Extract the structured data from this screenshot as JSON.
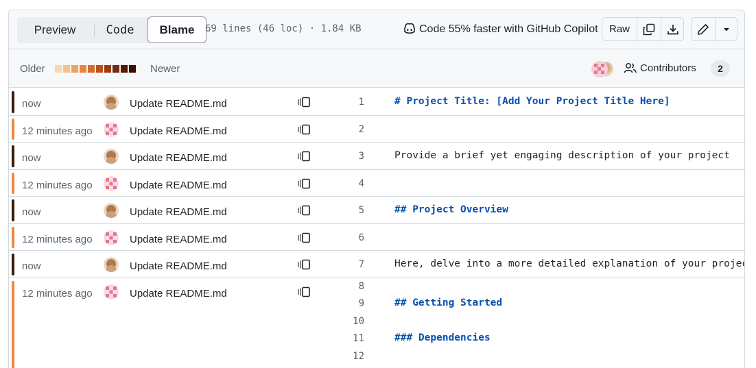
{
  "toolbar": {
    "tabs": {
      "preview": "Preview",
      "code": "Code",
      "blame": "Blame"
    },
    "file_info": "69 lines (46 loc) · 1.84 KB",
    "copilot_text": "Code 55% faster with GitHub Copilot",
    "raw_label": "Raw",
    "icons": [
      "copilot-icon",
      "copy-icon",
      "download-icon",
      "pencil-icon",
      "triangle-down-icon"
    ]
  },
  "legend": {
    "older": "Older",
    "newer": "Newer",
    "scale_colors": [
      "#f8d8a8",
      "#f7c28a",
      "#f2a25e",
      "#e8843f",
      "#d66a2c",
      "#bb4f1f",
      "#983a17",
      "#75290f",
      "#521a09",
      "#3a1004"
    ],
    "contributors_label": "Contributors",
    "contributors_count": "2"
  },
  "colors": {
    "recent": "#3a1a0a",
    "older": "#f0883e",
    "heading": "#0550ae"
  },
  "blame": {
    "rows": [
      {
        "age": "now",
        "message": "Update README.md",
        "author": "user-a",
        "recency": "recent",
        "lines": [
          {
            "n": "1",
            "text": "# Project Title: [Add Your Project Title Here]",
            "heading": true
          }
        ]
      },
      {
        "age": "12 minutes ago",
        "message": "Update README.md",
        "author": "user-b",
        "recency": "older",
        "lines": [
          {
            "n": "2",
            "text": "",
            "heading": false
          }
        ]
      },
      {
        "age": "now",
        "message": "Update README.md",
        "author": "user-a",
        "recency": "recent",
        "lines": [
          {
            "n": "3",
            "text": "Provide a brief yet engaging description of your project",
            "heading": false
          }
        ]
      },
      {
        "age": "12 minutes ago",
        "message": "Update README.md",
        "author": "user-b",
        "recency": "older",
        "lines": [
          {
            "n": "4",
            "text": "",
            "heading": false
          }
        ]
      },
      {
        "age": "now",
        "message": "Update README.md",
        "author": "user-a",
        "recency": "recent",
        "lines": [
          {
            "n": "5",
            "text": "## Project Overview",
            "heading": true
          }
        ]
      },
      {
        "age": "12 minutes ago",
        "message": "Update README.md",
        "author": "user-b",
        "recency": "older",
        "lines": [
          {
            "n": "6",
            "text": "",
            "heading": false
          }
        ]
      },
      {
        "age": "now",
        "message": "Update README.md",
        "author": "user-a",
        "recency": "recent",
        "lines": [
          {
            "n": "7",
            "text": "Here, delve into a more detailed explanation of your project",
            "heading": false
          }
        ]
      },
      {
        "age": "12 minutes ago",
        "message": "Update README.md",
        "author": "user-b",
        "recency": "older",
        "lines": [
          {
            "n": "8",
            "text": "",
            "heading": false
          },
          {
            "n": "9",
            "text": "## Getting Started",
            "heading": true
          },
          {
            "n": "10",
            "text": "",
            "heading": false
          },
          {
            "n": "11",
            "text": "### Dependencies",
            "heading": true
          },
          {
            "n": "12",
            "text": "",
            "heading": false
          }
        ]
      }
    ]
  }
}
